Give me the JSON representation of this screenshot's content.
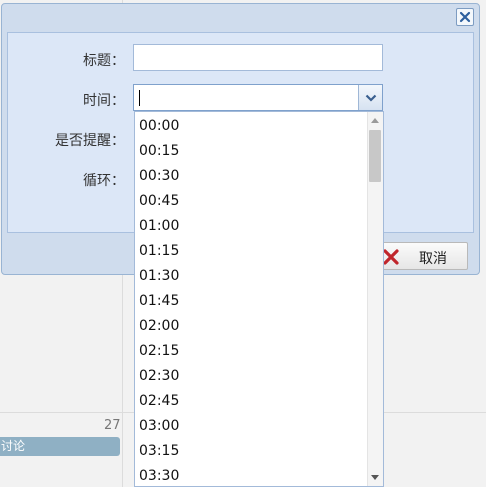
{
  "background": {
    "day_number": "27",
    "event_text": "讨论"
  },
  "dialog": {
    "fields": {
      "title_label": "标题：",
      "title_value": "",
      "time_label": "时间：",
      "time_value": "",
      "reminder_label": "是否提醒：",
      "repeat_label": "循环："
    },
    "cancel_label": "取消",
    "close_icon": "close-icon",
    "cancel_icon": "red-x-icon"
  },
  "time_dropdown": {
    "options": [
      "00:00",
      "00:15",
      "00:30",
      "00:45",
      "01:00",
      "01:15",
      "01:30",
      "01:45",
      "02:00",
      "02:15",
      "02:30",
      "02:45",
      "03:00",
      "03:15",
      "03:30"
    ]
  },
  "colors": {
    "dialog_bg": "#cfdced",
    "panel_bg": "#dce7f7",
    "border_blue": "#99b4d3",
    "cancel_icon_red": "#c0262c",
    "event_bg": "#8fb0c4"
  }
}
